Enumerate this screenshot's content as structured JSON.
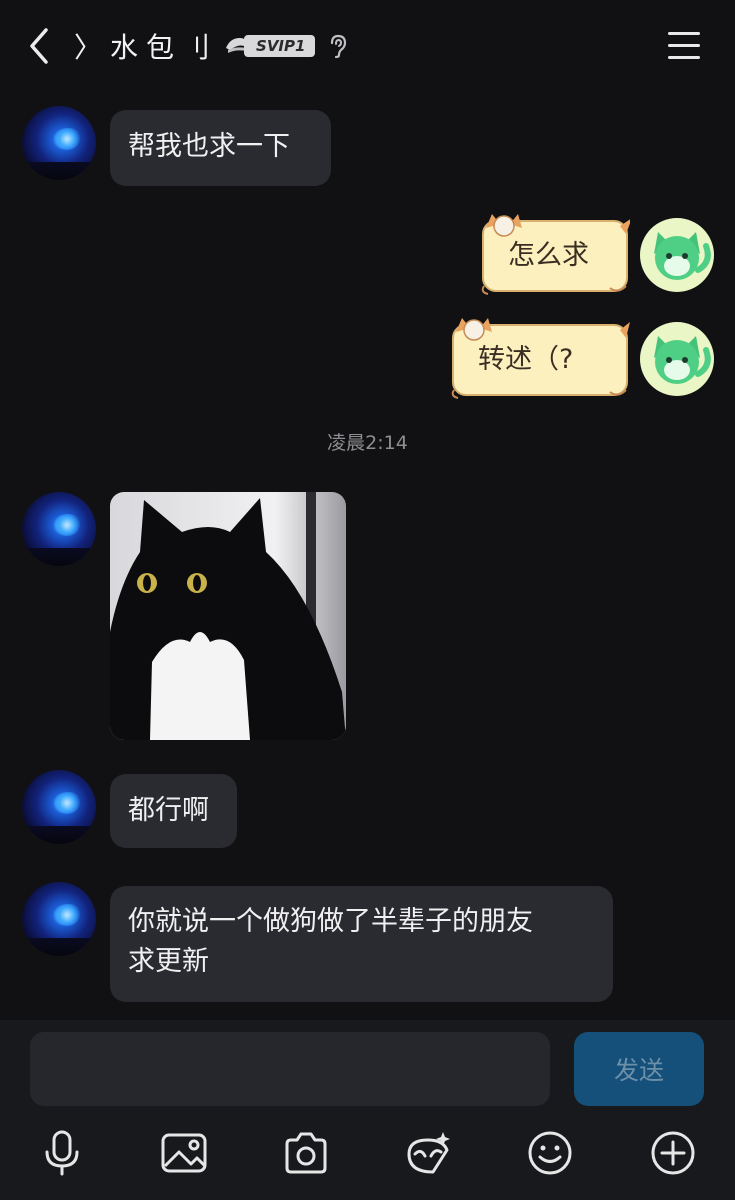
{
  "header": {
    "back_icon": "chevron-left-icon",
    "title": "〉水包刂",
    "badge": "SVIP1",
    "ear_icon": "ear-icon",
    "menu_icon": "hamburger-menu-icon"
  },
  "messages": [
    {
      "side": "left",
      "type": "text",
      "text": "帮我也求一下"
    },
    {
      "side": "right",
      "type": "text",
      "text": "怎么求"
    },
    {
      "side": "right",
      "type": "text",
      "text": "转述（?"
    },
    {
      "type": "time",
      "text": "凌晨2:14"
    },
    {
      "side": "left",
      "type": "image",
      "content": "tuxedo-cat-photo"
    },
    {
      "side": "left",
      "type": "text",
      "text": "都行啊"
    },
    {
      "side": "left",
      "type": "text",
      "lines": [
        "你就说一个做狗做了半辈子的朋友",
        "求更新"
      ]
    }
  ],
  "input": {
    "value": "",
    "placeholder": "",
    "send_label": "发送"
  },
  "toolbar": [
    "microphone-icon",
    "image-icon",
    "camera-icon",
    "sticker-icon",
    "emoji-icon",
    "plus-icon"
  ],
  "colors": {
    "background": "#111113",
    "incoming_bubble": "#2a2b30",
    "outgoing_bubble": "#fbf0be",
    "send_button": "#15507b"
  }
}
